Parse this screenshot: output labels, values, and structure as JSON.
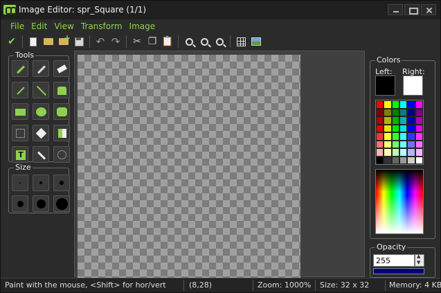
{
  "window": {
    "title": "Image Editor: spr_Square (1/1)"
  },
  "menu": {
    "items": [
      "File",
      "Edit",
      "View",
      "Transform",
      "Image"
    ]
  },
  "toolbar": {
    "buttons": [
      "check-icon",
      "new-icon",
      "open-icon",
      "add-file-icon",
      "save-icon",
      "undo-icon",
      "redo-icon",
      "cut-icon",
      "copy-icon",
      "paste-icon",
      "zoom-out-icon",
      "zoom-reset-icon",
      "zoom-in-icon",
      "grid-icon",
      "image-icon"
    ]
  },
  "tools": {
    "label": "Tools",
    "items": [
      "pencil-tool",
      "spray-tool",
      "eraser-tool",
      "color-picker-tool",
      "line-tool",
      "fill-tool",
      "rectangle-tool",
      "ellipse-tool",
      "rounded-rectangle-tool",
      "selection-tool",
      "magic-wand-tool",
      "brush-select-tool",
      "text-tool",
      "change-color-tool",
      "circle-select-tool"
    ]
  },
  "size": {
    "label": "Size"
  },
  "colors": {
    "label": "Colors",
    "left_label": "Left:",
    "right_label": "Right:",
    "left_color": "#000000",
    "right_color": "#ffffff"
  },
  "opacity": {
    "label": "Opacity",
    "value": "255"
  },
  "status": {
    "hint": "Paint with the mouse, <Shift> for hor/vert",
    "position": "(8,28)",
    "zoom": "Zoom: 1000%",
    "size": "Size: 32 x 32",
    "memory": "Memory: 4 KB"
  },
  "accent_color": "#8fd14f"
}
